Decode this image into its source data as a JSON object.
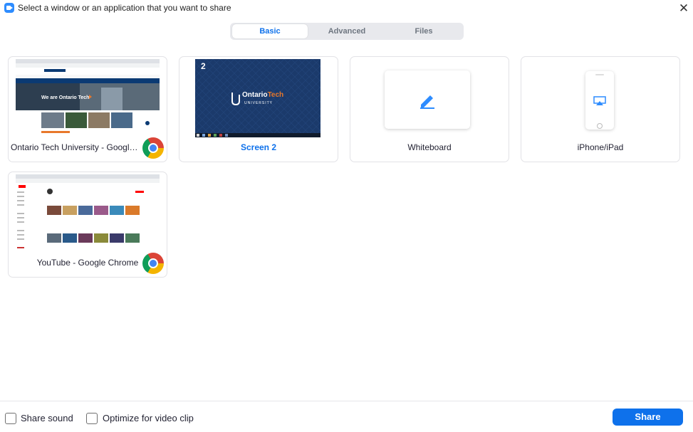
{
  "window": {
    "title": "Select a window or an application that you want to share",
    "close_glyph": "✕"
  },
  "tabs": [
    {
      "label": "Basic",
      "active": true
    },
    {
      "label": "Advanced",
      "active": false
    },
    {
      "label": "Files",
      "active": false
    }
  ],
  "share_items": [
    {
      "label": "Ontario Tech University - Google Chrome",
      "type": "window",
      "badge": "chrome-icon"
    },
    {
      "label": "Screen 2",
      "type": "screen",
      "selected": true,
      "screen_number": "2",
      "thumbnail_logo": "OntarioTech",
      "thumbnail_logo_sub": "UNIVERSITY"
    },
    {
      "label": "Whiteboard",
      "type": "whiteboard",
      "icon": "pencil-icon"
    },
    {
      "label": "iPhone/iPad",
      "type": "device",
      "icon": "airplay-icon"
    },
    {
      "label": "YouTube - Google Chrome",
      "type": "window",
      "badge": "chrome-icon"
    }
  ],
  "footer": {
    "share_sound_label": "Share sound",
    "share_sound_checked": false,
    "optimize_label": "Optimize for video clip",
    "optimize_checked": false,
    "share_button_label": "Share"
  },
  "colors": {
    "accent": "#0E71EB",
    "screen_bg": "#1B3A6B",
    "tech_orange": "#E8782B"
  }
}
